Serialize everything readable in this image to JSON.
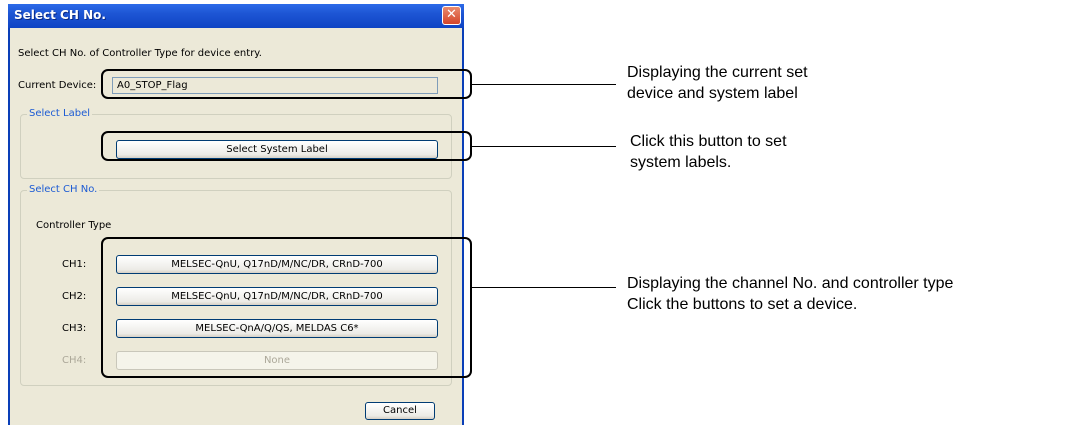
{
  "dialog": {
    "title": "Select CH No.",
    "close_glyph": "✕",
    "instruction": "Select CH No. of Controller Type for device entry.",
    "current_device_label": "Current Device:",
    "current_device_value": "A0_STOP_Flag",
    "select_label_group": "Select Label",
    "select_system_label_button": "Select System Label",
    "select_ch_group": "Select CH No.",
    "controller_type_label": "Controller Type",
    "channels": [
      {
        "label": "CH1:",
        "button": "MELSEC-QnU, Q17nD/M/NC/DR, CRnD-700",
        "enabled": true
      },
      {
        "label": "CH2:",
        "button": "MELSEC-QnU, Q17nD/M/NC/DR, CRnD-700",
        "enabled": true
      },
      {
        "label": "CH3:",
        "button": "MELSEC-QnA/Q/QS, MELDAS C6*",
        "enabled": true
      },
      {
        "label": "CH4:",
        "button": "None",
        "enabled": false
      }
    ],
    "cancel_button": "Cancel"
  },
  "annotations": {
    "current_device_line1": "Displaying the current set",
    "current_device_line2": "device and system label",
    "system_label_line1": "Click this button to set",
    "system_label_line2": "system labels.",
    "channels_line1": "Displaying the channel No. and controller type",
    "channels_line2": "Click the buttons to set a device."
  },
  "colors": {
    "titlebar": "#0e44c4",
    "dialog_bg": "#ece9d8",
    "group_title": "#1c5bd4",
    "callout_border": "#000000"
  }
}
